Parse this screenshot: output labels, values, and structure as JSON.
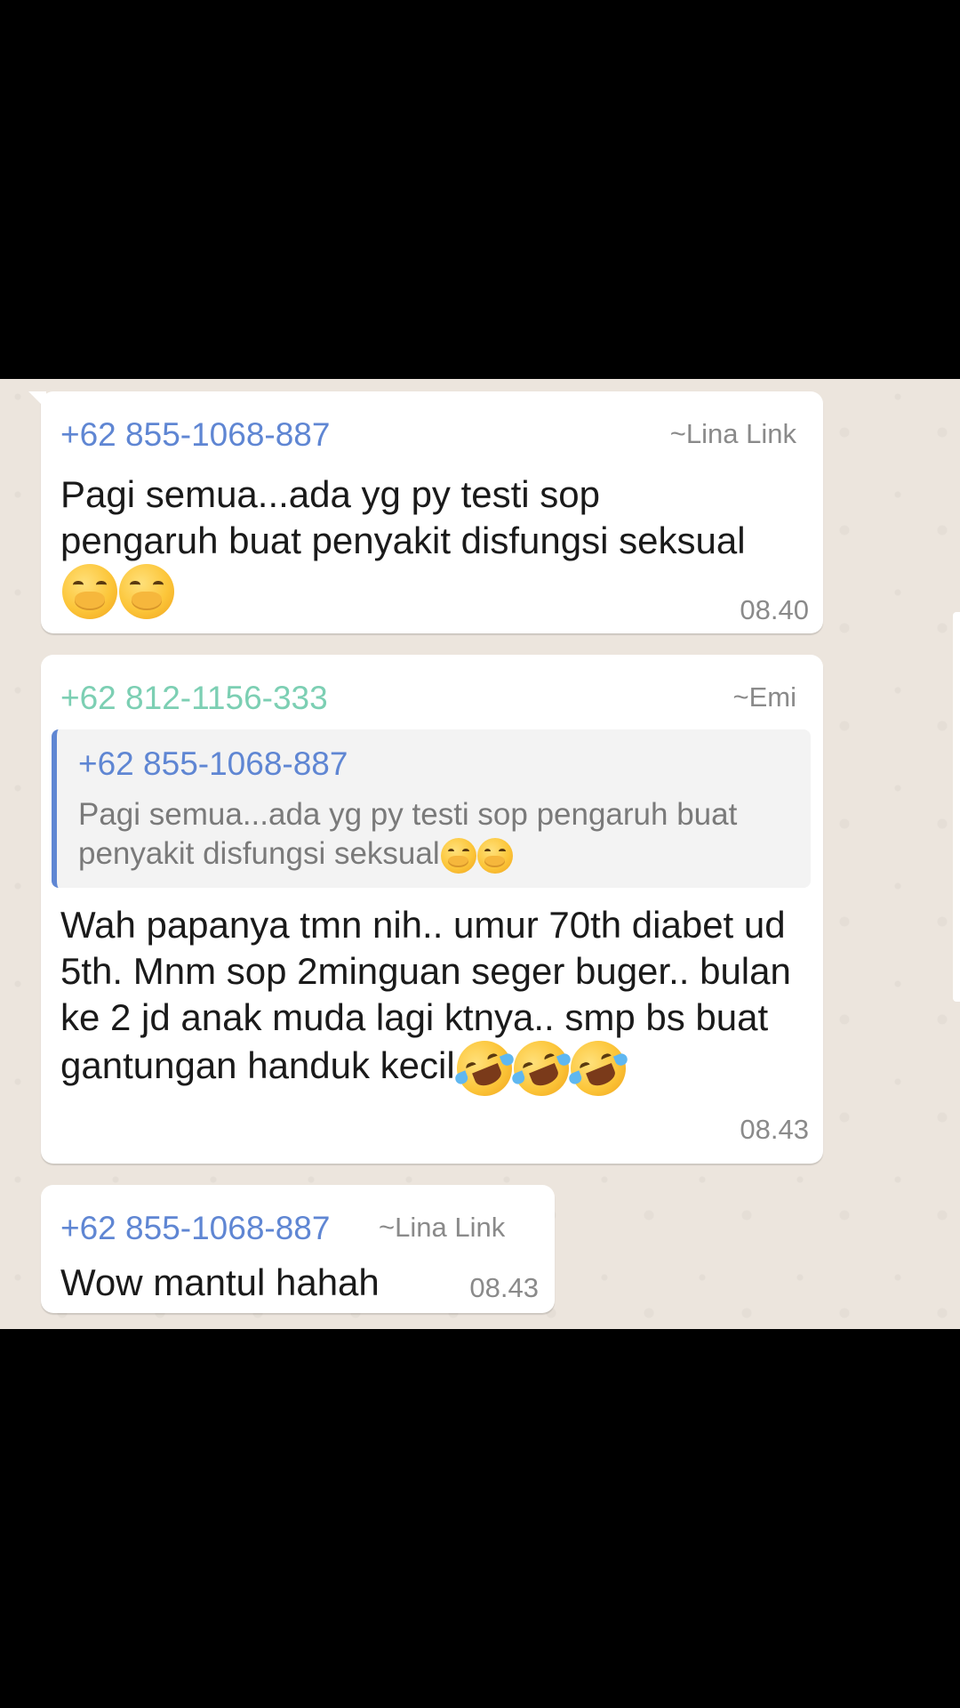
{
  "messages": [
    {
      "sender_phone": "+62 855-1068-887",
      "sender_name": "~Lina Link",
      "text": "Pagi semua...ada yg py testi sop pengaruh buat penyakit disfungsi seksual",
      "emojis": [
        "face-with-hand-over-mouth",
        "face-with-hand-over-mouth"
      ],
      "time": "08.40"
    },
    {
      "sender_phone": "+62 812-1156-333",
      "sender_name": "~Emi",
      "quoted": {
        "sender_phone": "+62 855-1068-887",
        "text": "Pagi semua...ada yg py testi sop pengaruh buat penyakit disfungsi seksual",
        "emojis": [
          "face-with-hand-over-mouth",
          "face-with-hand-over-mouth"
        ]
      },
      "text": "Wah papanya tmn nih.. umur 70th diabet ud 5th. Mnm sop 2minguan seger buger.. bulan ke 2 jd anak muda lagi ktnya.. smp bs buat gantungan handuk kecil",
      "emojis": [
        "rolling-on-the-floor-laughing",
        "rolling-on-the-floor-laughing",
        "rolling-on-the-floor-laughing"
      ],
      "time": "08.43"
    },
    {
      "sender_phone": "+62 855-1068-887",
      "sender_name": "~Lina Link",
      "text": "Wow mantul hahah",
      "time": "08.43"
    }
  ],
  "colors": {
    "chat_background": "#ece5dd",
    "bubble": "#ffffff",
    "sender_blue": "#5f86d3",
    "sender_teal": "#7ccfb3",
    "meta_grey": "#8a8a8a"
  }
}
